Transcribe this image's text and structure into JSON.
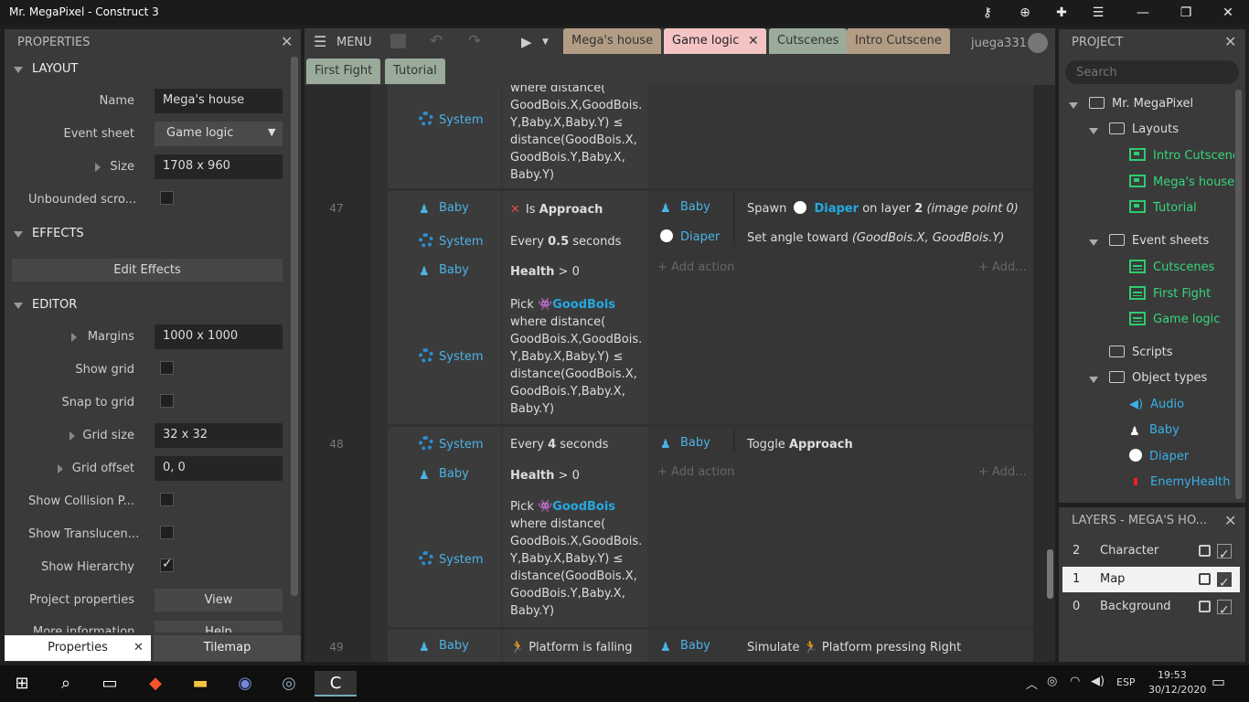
{
  "window": {
    "title": "Mr. MegaPixel - Construct 3"
  },
  "properties": {
    "header": "PROPERTIES",
    "layout_section": "LAYOUT",
    "name_label": "Name",
    "name_value": "Mega's house",
    "event_sheet_label": "Event sheet",
    "event_sheet_value": "Game logic",
    "size_label": "Size",
    "size_value": "1708 x 960",
    "unbounded_label": "Unbounded scro...",
    "effects_section": "EFFECTS",
    "edit_effects": "Edit Effects",
    "editor_section": "EDITOR",
    "margins_label": "Margins",
    "margins_value": "1000 x 1000",
    "show_grid": "Show grid",
    "snap_grid": "Snap to grid",
    "grid_size_label": "Grid size",
    "grid_size_value": "32 x 32",
    "grid_offset_label": "Grid offset",
    "grid_offset_value": "0, 0",
    "show_collision": "Show Collision P...",
    "show_translucent": "Show Translucen...",
    "show_hierarchy": "Show Hierarchy",
    "project_props": "Project properties",
    "view_btn": "View",
    "more_info": "More information",
    "help_btn": "Help",
    "tab_properties": "Properties",
    "tab_tilemap": "Tilemap"
  },
  "toolbar": {
    "menu": "MENU",
    "user": "juega331"
  },
  "tabs": [
    "Mega's house",
    "Game logic",
    "Cutscenes",
    "Intro Cutscene",
    "First Fight",
    "Tutorial"
  ],
  "events": {
    "top": {
      "obj": "System",
      "cond": [
        "where distance(",
        "GoodBois.X,GoodBois.",
        "Y,Baby.X,Baby.Y) ≤",
        "distance(GoodBois.X,",
        "GoodBois.Y,Baby.X,",
        "Baby.Y)"
      ]
    },
    "e47": {
      "num": "47",
      "c1_obj": "Baby",
      "c1_pre": "Is",
      "c1_b": "Approach",
      "c2_obj": "System",
      "c2_pre": "Every",
      "c2_b": "0.5",
      "c2_post": "seconds",
      "c3_obj": "Baby",
      "c3_b": "Health",
      "c3_post": "> 0",
      "c4_obj": "System",
      "c4_pick": "Pick",
      "c4_name": "GoodBois",
      "c4_lines": [
        "where distance(",
        "GoodBois.X,GoodBois.",
        "Y,Baby.X,Baby.Y) ≤",
        "distance(GoodBois.X,",
        "GoodBois.Y,Baby.X,",
        "Baby.Y)"
      ],
      "a1_obj": "Baby",
      "a1_pre": "Spawn",
      "a1_name": "Diaper",
      "a1_mid": "on layer",
      "a1_b": "2",
      "a1_post": "(image point 0)",
      "a2_obj": "Diaper",
      "a2_pre": "Set angle toward",
      "a2_post": "(GoodBois.X, GoodBois.Y)",
      "add_action": "+ Add action",
      "add_short": "+ Add..."
    },
    "e48": {
      "num": "48",
      "c1_obj": "System",
      "c1_pre": "Every",
      "c1_b": "4",
      "c1_post": "seconds",
      "c2_obj": "Baby",
      "c2_b": "Health",
      "c2_post": "> 0",
      "c3_obj": "System",
      "c3_pick": "Pick",
      "c3_name": "GoodBois",
      "c3_lines": [
        "where distance(",
        "GoodBois.X,GoodBois.",
        "Y,Baby.X,Baby.Y) ≤",
        "distance(GoodBois.X,",
        "GoodBois.Y,Baby.X,",
        "Baby.Y)"
      ],
      "a1_obj": "Baby",
      "a1_pre": "Toggle",
      "a1_b": "Approach",
      "add_action": "+ Add action",
      "add_short": "+ Add..."
    },
    "e49": {
      "num": "49",
      "c1_obj": "Baby",
      "c1_text": "Platform is falling",
      "a1_obj": "Baby",
      "a1_pre": "Simulate",
      "a1_post": "Platform pressing Right"
    }
  },
  "project": {
    "header": "PROJECT",
    "search_placeholder": "Search",
    "root": "Mr. MegaPixel",
    "layouts": "Layouts",
    "layout_items": [
      "Intro Cutscene",
      "Mega's house",
      "Tutorial"
    ],
    "event_sheets": "Event sheets",
    "sheet_items": [
      "Cutscenes",
      "First Fight",
      "Game logic"
    ],
    "scripts": "Scripts",
    "object_types": "Object types",
    "objects": [
      "Audio",
      "Baby",
      "Diaper",
      "EnemyHealth"
    ]
  },
  "layers": {
    "header": "LAYERS - MEGA'S HO...",
    "rows": [
      {
        "n": "2",
        "name": "Character"
      },
      {
        "n": "1",
        "name": "Map"
      },
      {
        "n": "0",
        "name": "Background"
      }
    ]
  },
  "taskbar": {
    "lang": "ESP",
    "time": "19:53",
    "date": "30/12/2020"
  }
}
